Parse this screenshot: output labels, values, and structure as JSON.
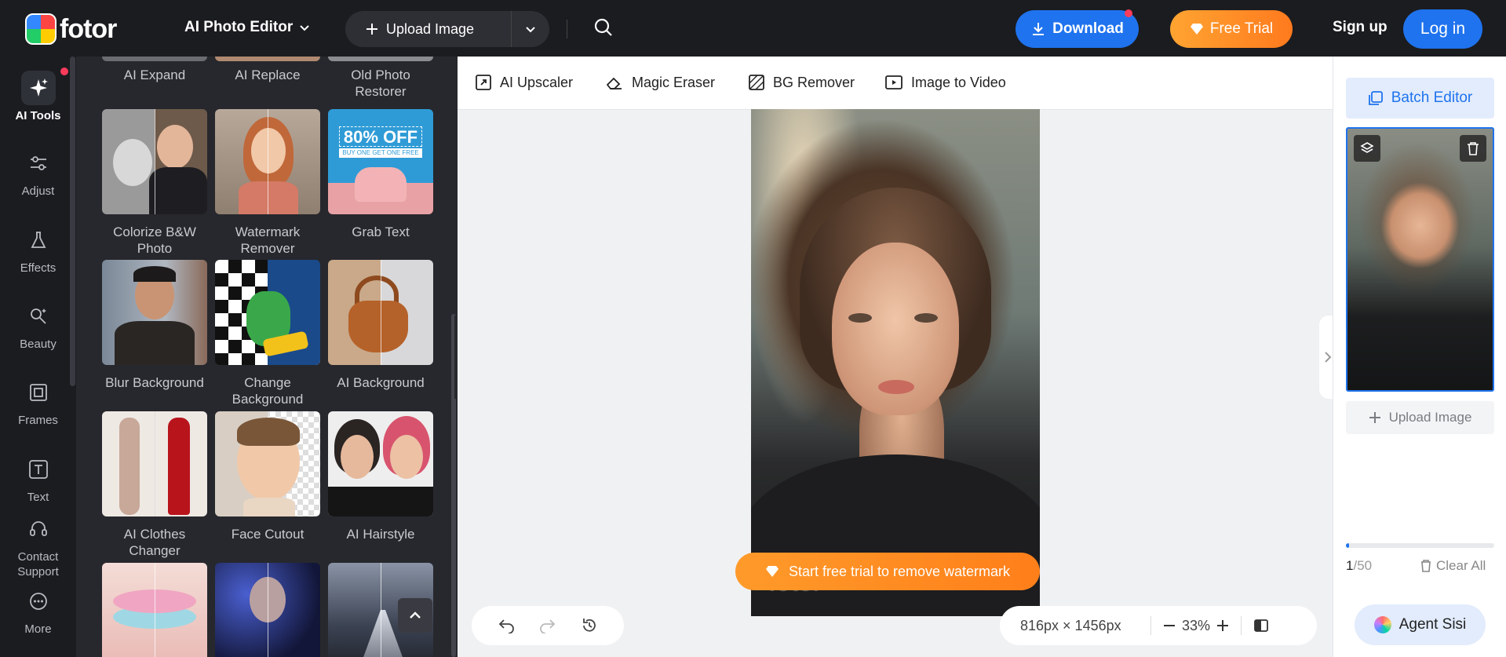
{
  "brand": {
    "name": "fotor"
  },
  "header": {
    "editor_label": "AI Photo Editor",
    "upload_label": "Upload Image",
    "download_label": "Download",
    "trial_label": "Free Trial",
    "signup_label": "Sign up",
    "login_label": "Log in"
  },
  "rail": {
    "items": [
      {
        "label": "AI Tools"
      },
      {
        "label": "Adjust"
      },
      {
        "label": "Effects"
      },
      {
        "label": "Beauty"
      },
      {
        "label": "Frames"
      },
      {
        "label": "Text"
      },
      {
        "label": "Contact Support"
      },
      {
        "label": "More"
      }
    ]
  },
  "panel": {
    "top_tiles": [
      "AI Expand",
      "AI Replace",
      "Old Photo Restorer"
    ],
    "tiles": [
      {
        "label": "Colorize B&W Photo",
        "promo": ""
      },
      {
        "label": "Watermark Remover",
        "promo": ""
      },
      {
        "label": "Grab Text",
        "promo": "80% OFF",
        "promo_sub": "BUY ONE GET ONE FREE"
      },
      {
        "label": "Blur Background"
      },
      {
        "label": "Change Background"
      },
      {
        "label": "AI Background"
      },
      {
        "label": "AI Clothes Changer"
      },
      {
        "label": "Face Cutout"
      },
      {
        "label": "AI Hairstyle"
      }
    ]
  },
  "quickbar": {
    "tools": [
      "AI Upscaler",
      "Magic Eraser",
      "BG Remover",
      "Image to Video"
    ]
  },
  "canvas": {
    "watermark_cta": "Start free trial to remove watermark",
    "watermark_text": "fotor",
    "dimensions": "816px × 1456px",
    "zoom": "33%"
  },
  "right_panel": {
    "batch_label": "Batch Editor",
    "upload_label": "Upload Image",
    "count_current": "1",
    "count_total": "/50",
    "progress": 0.02,
    "clear_label": "Clear All",
    "agent_label": "Agent Sisi"
  },
  "colors": {
    "accent": "#1f73ee",
    "trial": "#ff8f24",
    "dark_bg": "#1b1c20",
    "panel_bg": "#27282d"
  }
}
